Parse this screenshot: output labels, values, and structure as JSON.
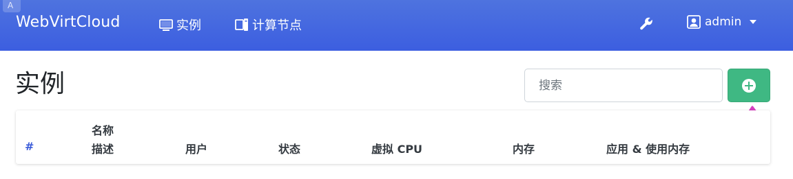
{
  "navbar": {
    "brand": "WebVirtCloud",
    "links": [
      {
        "label": "实例",
        "icon": "desktop-icon"
      },
      {
        "label": "计算节点",
        "icon": "server-icon"
      }
    ],
    "tools_icon": "wrench-icon",
    "user": {
      "label": "admin",
      "icon": "user-icon"
    },
    "color": "#4e73df"
  },
  "page": {
    "title": "实例"
  },
  "search": {
    "placeholder": "搜索",
    "value": ""
  },
  "add_button": {
    "icon": "plus-circle-icon",
    "color": "#3fb883"
  },
  "annotation": {
    "icon": "arrow-up-icon",
    "color": "#d63fbf"
  },
  "table": {
    "headers": {
      "hash": "#",
      "name": "名称",
      "description": "描述",
      "user": "用户",
      "status": "状态",
      "vcpu": "虚拟 CPU",
      "memory": "内存",
      "apply_usage": "应用 & 使用内存"
    },
    "rows": []
  }
}
